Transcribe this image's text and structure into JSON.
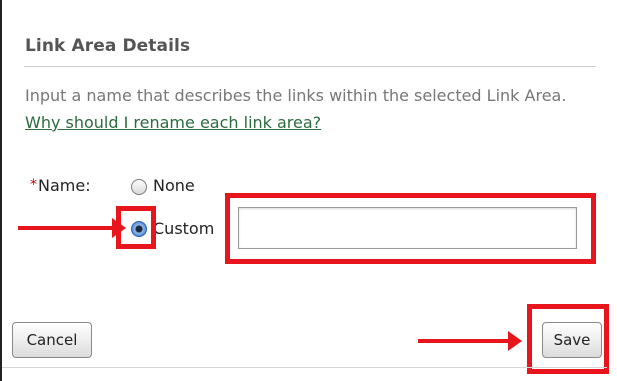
{
  "dialog": {
    "title": "Link Area Details",
    "description": "Input a name that describes the links within the selected Link Area.",
    "help_link": "Why should I rename each link area?"
  },
  "name_field": {
    "required_marker": "*",
    "label": "Name:",
    "options": [
      {
        "label": "None",
        "selected": false
      },
      {
        "label": "Custom",
        "selected": true
      }
    ],
    "custom_value": "",
    "custom_placeholder": ""
  },
  "buttons": {
    "cancel_label": "Cancel",
    "save_label": "Save"
  },
  "colors": {
    "annotation_red": "#e8161c",
    "link_green": "#2c6b3f",
    "required_red": "#cc0000"
  }
}
